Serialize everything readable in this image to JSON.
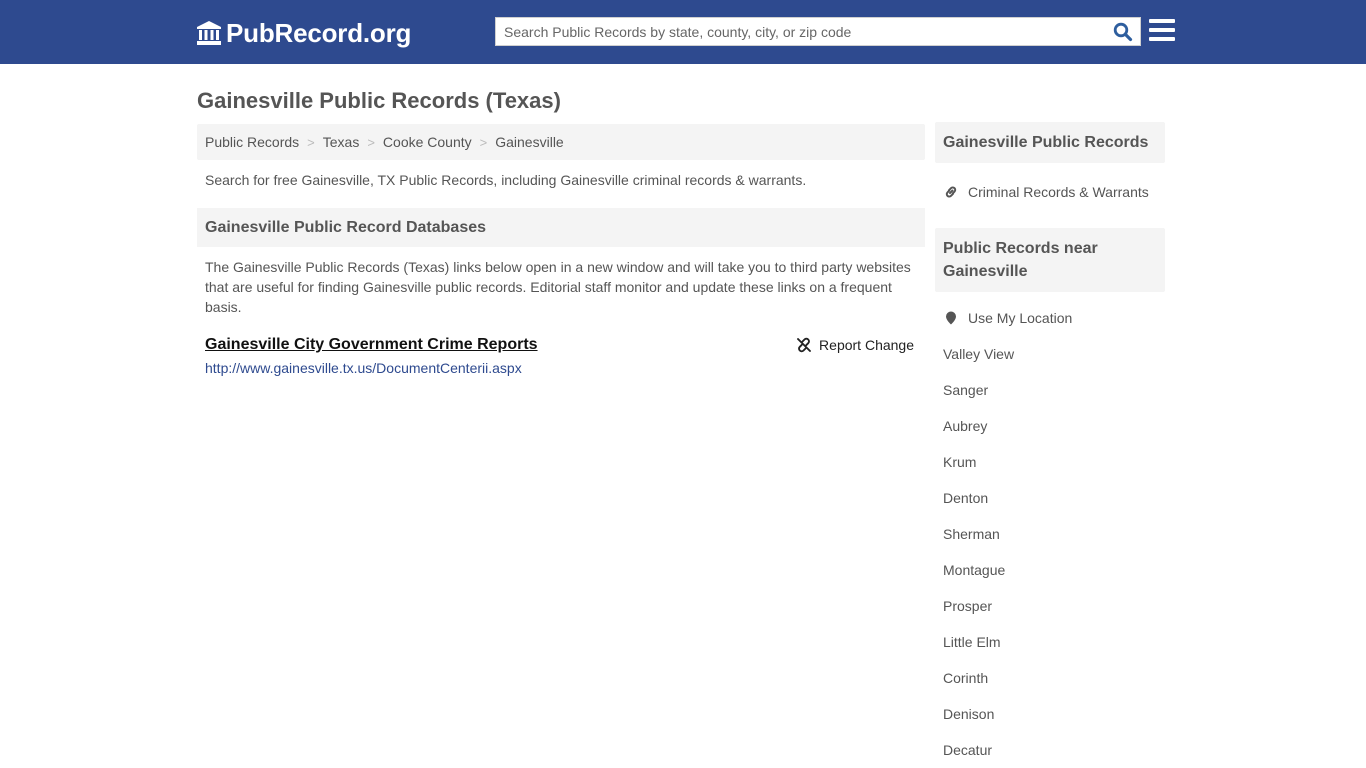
{
  "header": {
    "logo_text": "PubRecord.org",
    "search_placeholder": "Search Public Records by state, county, city, or zip code",
    "search_value": "",
    "brand_color": "#2e4a8f"
  },
  "page": {
    "title": "Gainesville Public Records (Texas)"
  },
  "breadcrumb": [
    {
      "label": "Public Records"
    },
    {
      "label": "Texas"
    },
    {
      "label": "Cooke County"
    },
    {
      "label": "Gainesville"
    }
  ],
  "breadcrumb_separator": ">",
  "main": {
    "intro": "Search for free Gainesville, TX Public Records, including Gainesville criminal records & warrants.",
    "databases_heading": "Gainesville Public Record Databases",
    "databases_description": "The Gainesville Public Records (Texas) links below open in a new window and will take you to third party websites that are useful for finding Gainesville public records. Editorial staff monitor and update these links on a frequent basis.",
    "records": [
      {
        "title": "Gainesville City Government Crime Reports",
        "url": "http://www.gainesville.tx.us/DocumentCenterii.aspx",
        "report_label": "Report Change"
      }
    ]
  },
  "sidebar": {
    "records_heading": "Gainesville Public Records",
    "records_links": [
      {
        "label": "Criminal Records & Warrants",
        "icon": "link-icon"
      }
    ],
    "nearby_heading": "Public Records near Gainesville",
    "location_label": "Use My Location",
    "nearby_cities": [
      "Valley View",
      "Sanger",
      "Aubrey",
      "Krum",
      "Denton",
      "Sherman",
      "Montague",
      "Prosper",
      "Little Elm",
      "Corinth",
      "Denison",
      "Decatur"
    ]
  }
}
